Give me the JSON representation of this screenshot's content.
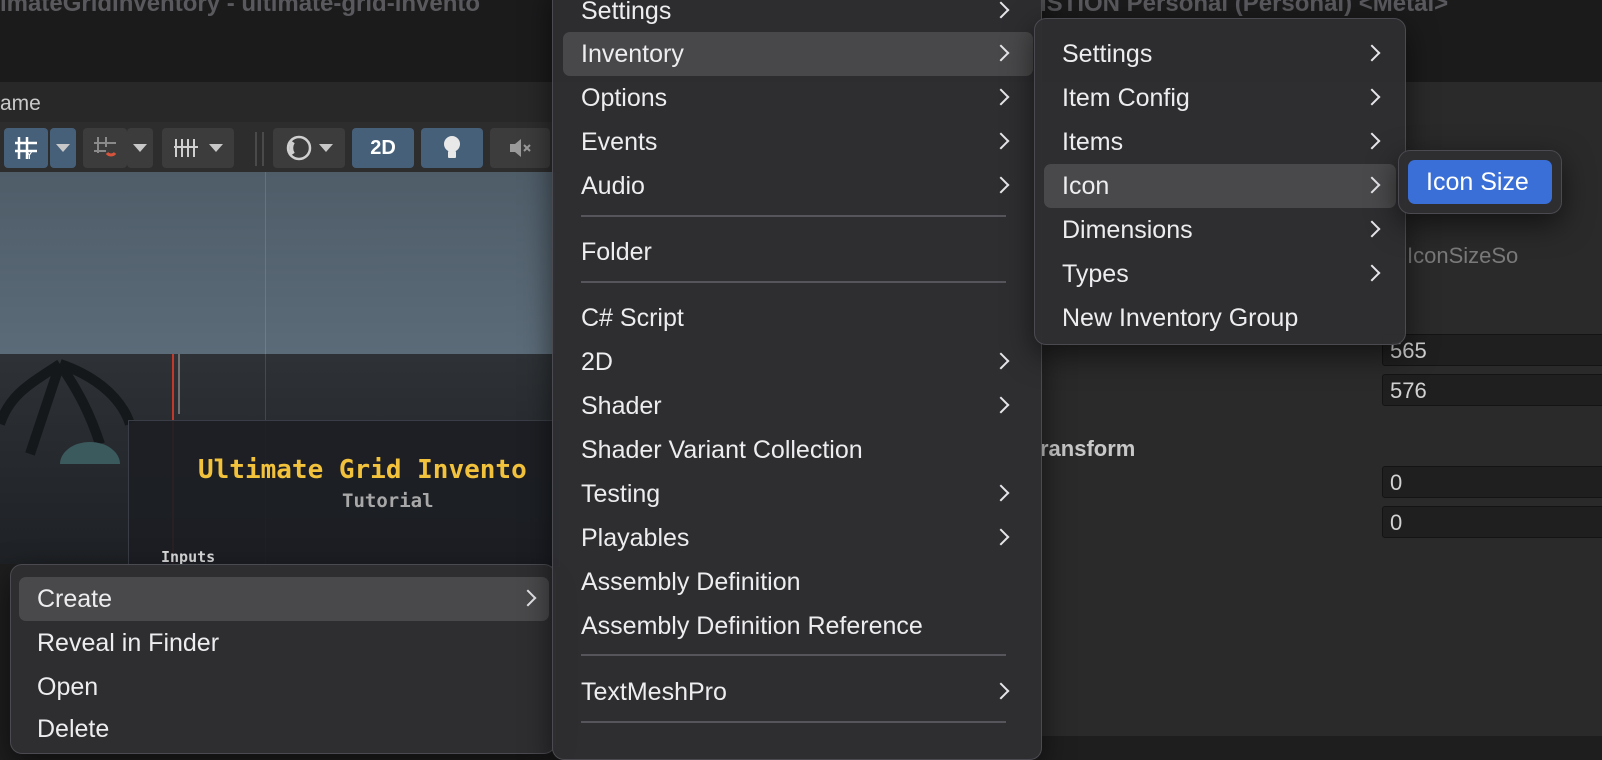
{
  "titlebar": {
    "left_text": "imateGridInventory - ultimate-grid-invento",
    "right_text": "ISTION Personal (Personal) <Metal>"
  },
  "scene_tab": {
    "label": "ame"
  },
  "toolbar": {
    "mode_2d_label": "2D"
  },
  "scene": {
    "title": "Ultimate Grid Invento",
    "subtitle": "Tutorial",
    "inputs_label": "Inputs"
  },
  "inspector": {
    "placeholder": "IconSizeSo",
    "field_1": "565",
    "field_2": "576",
    "section_label": "ransform",
    "field_3": "0",
    "field_4": "0"
  },
  "context_menu": {
    "items": [
      {
        "label": "Create",
        "submenu": true,
        "highlighted": true
      },
      {
        "label": "Reveal in Finder"
      },
      {
        "label": "Open"
      },
      {
        "label": "Delete"
      }
    ]
  },
  "create_menu": {
    "items": [
      {
        "label": "Settings",
        "submenu": true
      },
      {
        "label": "Inventory",
        "submenu": true,
        "highlighted": true
      },
      {
        "label": "Options",
        "submenu": true
      },
      {
        "label": "Events",
        "submenu": true
      },
      {
        "label": "Audio",
        "submenu": true
      },
      {
        "label": "Folder"
      },
      {
        "label": "C# Script"
      },
      {
        "label": "2D",
        "submenu": true
      },
      {
        "label": "Shader",
        "submenu": true
      },
      {
        "label": "Shader Variant Collection"
      },
      {
        "label": "Testing",
        "submenu": true
      },
      {
        "label": "Playables",
        "submenu": true
      },
      {
        "label": "Assembly Definition"
      },
      {
        "label": "Assembly Definition Reference"
      },
      {
        "label": "TextMeshPro",
        "submenu": true
      }
    ]
  },
  "inventory_menu": {
    "items": [
      {
        "label": "Settings",
        "submenu": true
      },
      {
        "label": "Item Config",
        "submenu": true
      },
      {
        "label": "Items",
        "submenu": true
      },
      {
        "label": "Icon",
        "submenu": true,
        "highlighted": true
      },
      {
        "label": "Dimensions",
        "submenu": true
      },
      {
        "label": "Types",
        "submenu": true
      },
      {
        "label": "New Inventory Group"
      }
    ]
  },
  "icon_menu": {
    "items": [
      {
        "label": "Icon Size",
        "selected": true
      }
    ]
  },
  "colors": {
    "accent": "#3a6fd8",
    "title_yellow": "#f3c23c"
  }
}
